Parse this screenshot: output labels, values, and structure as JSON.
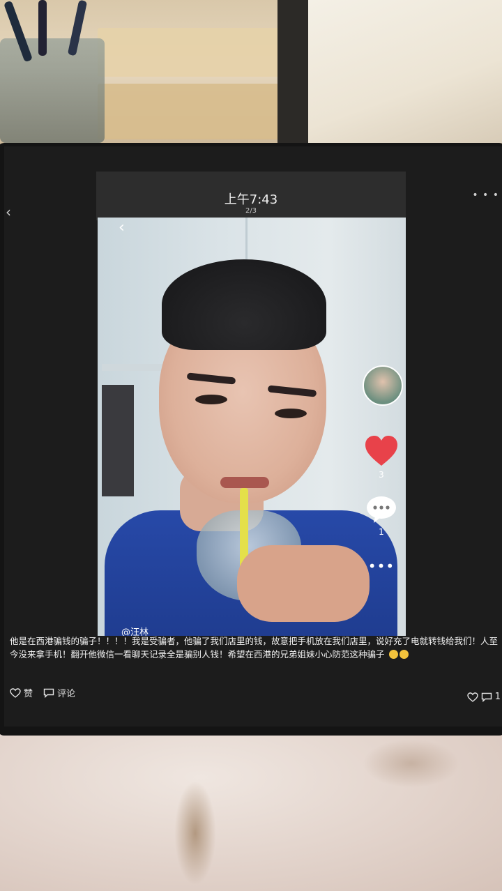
{
  "header": {
    "time": "上午7:43",
    "page_indicator": "2/3"
  },
  "video_overlay": {
    "like_count": "3",
    "comment_count": "1",
    "username_fragment": "@汪林"
  },
  "post": {
    "caption": "他是在西港骗钱的骗子！！！！我是受骗者，他骗了我们店里的钱，故意把手机放在我们店里，说好充了电就转钱给我们！人至今没来拿手机！翻开他微信一看聊天记录全是骗别人钱！希望在西港的兄弟姐妹小心防范这种骗子",
    "like_label": "赞",
    "comment_label": "评论",
    "right_count": "1"
  },
  "colors": {
    "like_red": "#e8424a",
    "screen_bg": "#1c1c1c"
  }
}
